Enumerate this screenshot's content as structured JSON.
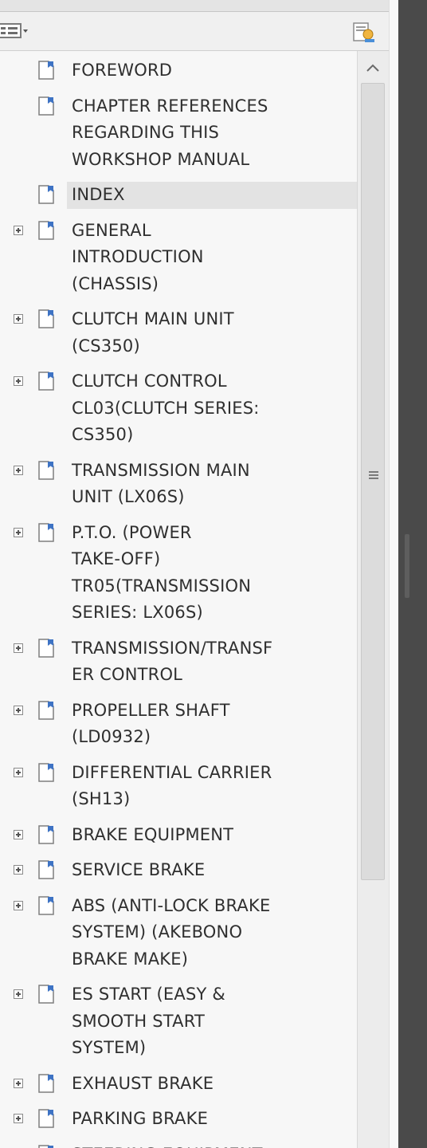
{
  "toolbar": {
    "options_icon": "options-menu-icon",
    "attach_icon": "attachment-icon"
  },
  "bookmarks": [
    {
      "label": "FOREWORD",
      "lines": [
        "FOREWORD"
      ],
      "expandable": false
    },
    {
      "label": "CHAPTER REFERENCES REGARDING THIS WORKSHOP MANUAL",
      "lines": [
        "CHAPTER REFERENCES",
        "REGARDING THIS",
        "WORKSHOP MANUAL"
      ],
      "expandable": false
    },
    {
      "label": "INDEX",
      "lines": [
        "INDEX"
      ],
      "expandable": false,
      "selected": true
    },
    {
      "label": "GENERAL INTRODUCTION (CHASSIS)",
      "lines": [
        "GENERAL",
        "INTRODUCTION",
        "(CHASSIS)"
      ],
      "expandable": true
    },
    {
      "label": "CLUTCH MAIN UNIT (CS350)",
      "lines": [
        "CLUTCH MAIN UNIT",
        "(CS350)"
      ],
      "expandable": true
    },
    {
      "label": "CLUTCH CONTROL CL03(CLUTCH SERIES: CS350)",
      "lines": [
        "CLUTCH CONTROL",
        "CL03(CLUTCH SERIES:",
        "CS350)"
      ],
      "expandable": true
    },
    {
      "label": "TRANSMISSION MAIN UNIT (LX06S)",
      "lines": [
        "TRANSMISSION MAIN",
        "UNIT (LX06S)"
      ],
      "expandable": true
    },
    {
      "label": "P.T.O. (POWER TAKE-OFF) TR05(TRANSMISSION SERIES: LX06S)",
      "lines": [
        "P.T.O. (POWER",
        "TAKE-OFF)",
        "TR05(TRANSMISSION",
        "SERIES: LX06S)"
      ],
      "expandable": true
    },
    {
      "label": "TRANSMISSION/TRANSFER CONTROL",
      "lines": [
        "TRANSMISSION/TRANSF",
        "ER CONTROL"
      ],
      "expandable": true
    },
    {
      "label": "PROPELLER SHAFT (LD0932)",
      "lines": [
        "PROPELLER SHAFT",
        "(LD0932)"
      ],
      "expandable": true
    },
    {
      "label": "DIFFERENTIAL CARRIER (SH13)",
      "lines": [
        "DIFFERENTIAL CARRIER",
        "(SH13)"
      ],
      "expandable": true
    },
    {
      "label": "BRAKE EQUIPMENT",
      "lines": [
        "BRAKE EQUIPMENT"
      ],
      "expandable": true
    },
    {
      "label": "SERVICE BRAKE",
      "lines": [
        "SERVICE BRAKE"
      ],
      "expandable": true
    },
    {
      "label": "ABS (ANTI-LOCK BRAKE SYSTEM) (AKEBONO BRAKE MAKE)",
      "lines": [
        "ABS (ANTI-LOCK BRAKE",
        "SYSTEM) (AKEBONO",
        "BRAKE MAKE)"
      ],
      "expandable": true
    },
    {
      "label": "ES START (EASY & SMOOTH START SYSTEM)",
      "lines": [
        "ES START (EASY &",
        "SMOOTH START",
        "SYSTEM)"
      ],
      "expandable": true
    },
    {
      "label": "EXHAUST BRAKE",
      "lines": [
        "EXHAUST BRAKE"
      ],
      "expandable": true
    },
    {
      "label": "PARKING BRAKE",
      "lines": [
        "PARKING BRAKE"
      ],
      "expandable": true
    },
    {
      "label": "STEERING EQUIPMENT",
      "lines": [
        "STEERING EQUIPMENT"
      ],
      "expandable": true
    }
  ]
}
